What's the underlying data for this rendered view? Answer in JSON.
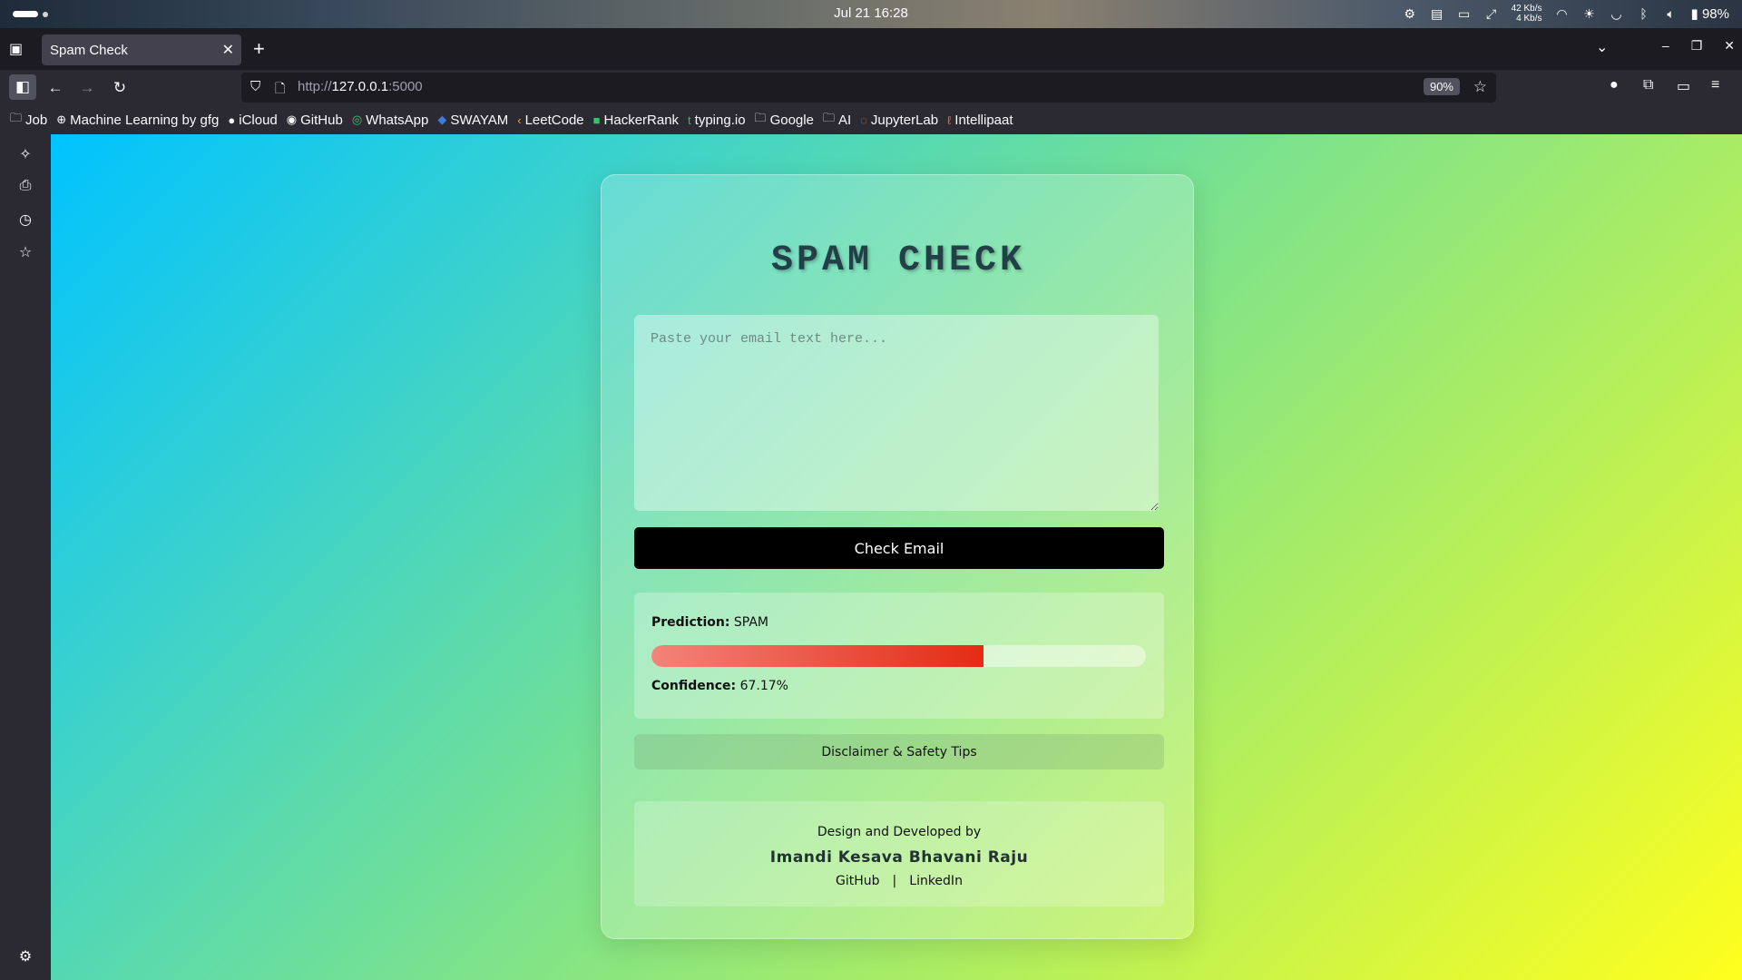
{
  "os": {
    "clock": "Jul 21  16:28",
    "net_up": "42 Kb/s",
    "net_down": "4 Kb/s",
    "battery": "98%"
  },
  "browser": {
    "tab_title": "Spam Check",
    "url_scheme": "http://",
    "url_host": "127.0.0.1",
    "url_port": ":5000",
    "zoom": "90%"
  },
  "bookmarks": [
    {
      "label": "Job",
      "icon": "folder-icon"
    },
    {
      "label": "Machine Learning by gfg",
      "icon": "globe-icon"
    },
    {
      "label": "iCloud",
      "icon": "apple-icon"
    },
    {
      "label": "GitHub",
      "icon": "github-icon"
    },
    {
      "label": "WhatsApp",
      "icon": "whatsapp-icon"
    },
    {
      "label": "SWAYAM",
      "icon": "swayam-icon"
    },
    {
      "label": "LeetCode",
      "icon": "leetcode-icon"
    },
    {
      "label": "HackerRank",
      "icon": "hackerrank-icon"
    },
    {
      "label": "typing.io",
      "icon": "typing-icon"
    },
    {
      "label": "Google",
      "icon": "folder-icon"
    },
    {
      "label": "AI",
      "icon": "folder-icon"
    },
    {
      "label": "JupyterLab",
      "icon": "jupyter-icon"
    },
    {
      "label": "Intellipaat",
      "icon": "intellipaat-icon"
    }
  ],
  "page": {
    "title": "SPAM CHECK",
    "input_placeholder": "Paste your email text here...",
    "input_value": "",
    "check_button": "Check Email",
    "prediction_label": "Prediction:",
    "prediction_value": "SPAM",
    "confidence_label": "Confidence:",
    "confidence_value": "67.17%",
    "confidence_fraction": 0.6717,
    "disclaimer_button": "Disclaimer & Safety Tips",
    "footer_caption": "Design and Developed by",
    "footer_author": "Imandi Kesava Bhavani Raju",
    "footer_link_github": "GitHub",
    "footer_separator": "|",
    "footer_link_linkedin": "LinkedIn"
  },
  "colors": {
    "spam_fill_start": "#f3837a",
    "spam_fill_end": "#e42b14",
    "button_bg": "#000000"
  }
}
